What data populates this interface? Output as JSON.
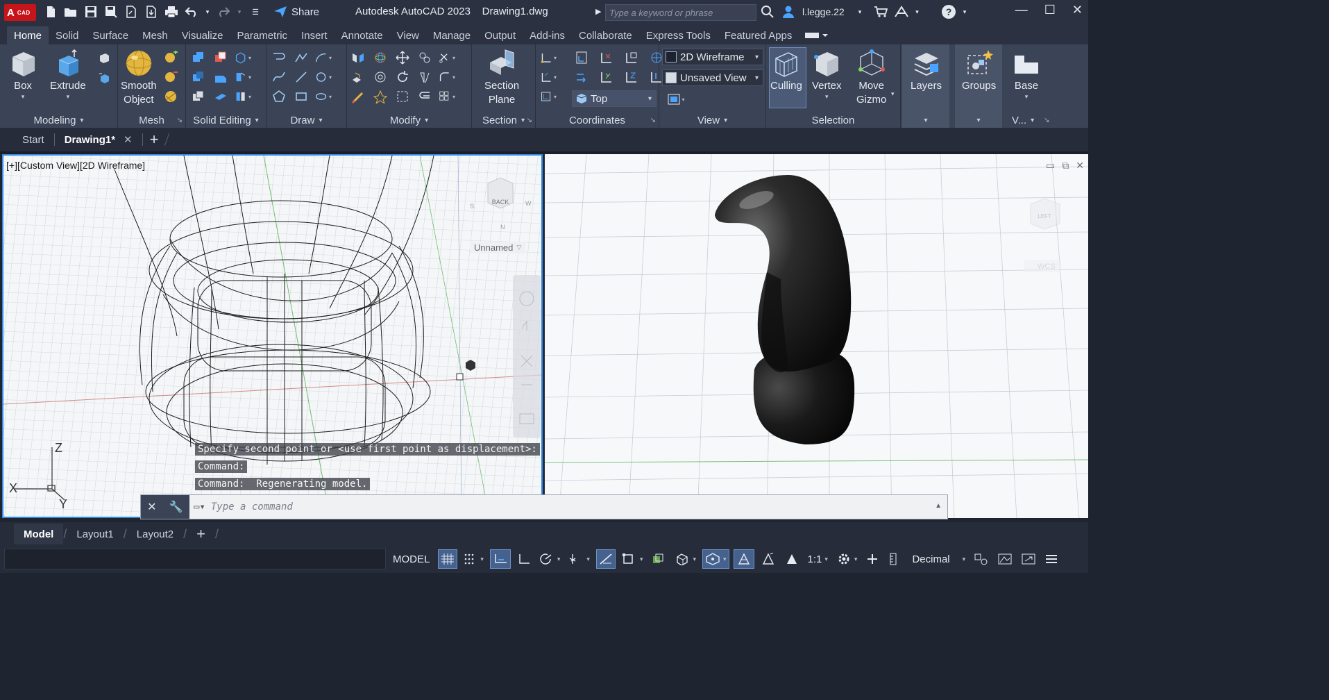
{
  "app": {
    "logo_text": "A",
    "logo_sub": "CAD",
    "title": "Autodesk AutoCAD 2023    Drawing1.dwg",
    "share_label": "Share",
    "search_placeholder": "Type a keyword or phrase",
    "username": "l.legge.22"
  },
  "ribbon_tabs": [
    "Home",
    "Solid",
    "Surface",
    "Mesh",
    "Visualize",
    "Parametric",
    "Insert",
    "Annotate",
    "View",
    "Manage",
    "Output",
    "Add-ins",
    "Collaborate",
    "Express Tools",
    "Featured Apps"
  ],
  "ribbon": {
    "box_label": "Box",
    "extrude_label": "Extrude",
    "smooth_object_label_1": "Smooth",
    "smooth_object_label_2": "Object",
    "section_plane_label_1": "Section",
    "section_plane_label_2": "Plane",
    "culling_label": "Culling",
    "vertex_label": "Vertex",
    "move_gizmo_label_1": "Move",
    "move_gizmo_label_2": "Gizmo",
    "layers_label": "Layers",
    "groups_label": "Groups",
    "base_label": "Base",
    "visual_style": "2D Wireframe",
    "named_view": "Unsaved View",
    "ucs_view": "Top",
    "panels": {
      "modeling": "Modeling",
      "mesh": "Mesh",
      "solid_editing": "Solid Editing",
      "draw": "Draw",
      "modify": "Modify",
      "section": "Section",
      "coordinates": "Coordinates",
      "view": "View",
      "selection": "Selection",
      "view_short": "V..."
    }
  },
  "file_tabs": {
    "start": "Start",
    "drawing": "Drawing1*"
  },
  "viewport_left": {
    "label": "[+][Custom View][2D Wireframe]",
    "viewcube_face": "BACK",
    "named_ucs": "Unnamed",
    "axis_z": "Z",
    "axis_x": "X",
    "axis_y": "Y"
  },
  "viewport_right": {
    "viewcube_face": "LEFT",
    "ucs_label": "WCS"
  },
  "command_history": [
    "Specify second point or <use first point as displacement>:",
    "Command:",
    "Command:  Regenerating model."
  ],
  "command_line": {
    "placeholder": "Type a command"
  },
  "layout_tabs": [
    "Model",
    "Layout1",
    "Layout2"
  ],
  "status": {
    "model": "MODEL",
    "scale": "1:1",
    "units": "Decimal"
  },
  "colors": {
    "accent": "#2f8ae6",
    "ribbon_bg": "#3b4456",
    "title_bg": "#2b3140",
    "brand_red": "#c7141a"
  }
}
